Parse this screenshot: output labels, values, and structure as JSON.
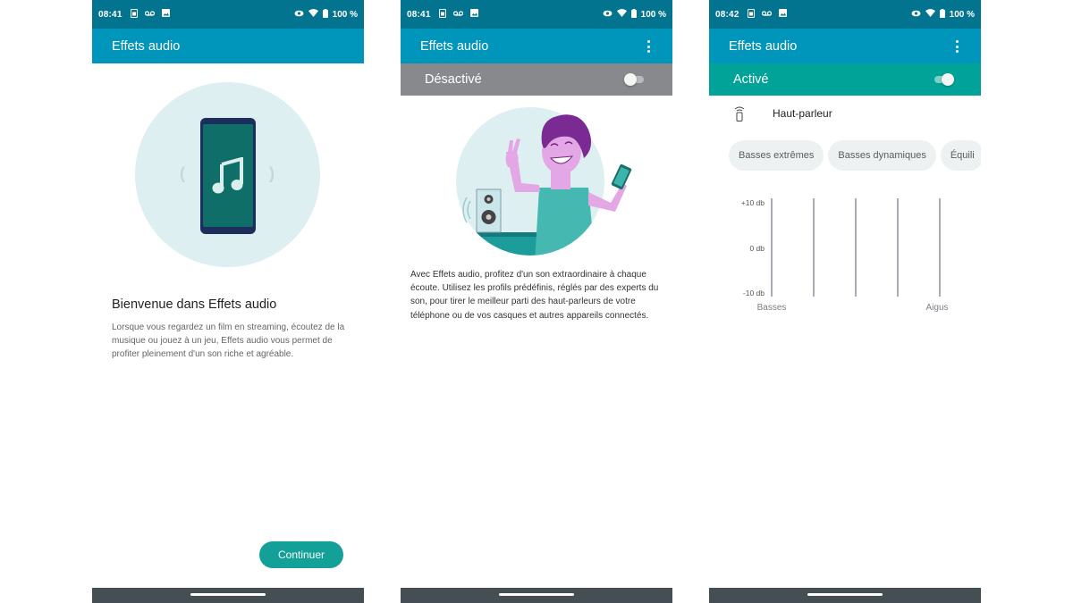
{
  "screens": [
    {
      "status": {
        "time": "08:41",
        "battery": "100 %"
      },
      "app_title": "Effets audio",
      "welcome_title": "Bienvenue dans Effets audio",
      "welcome_body": "Lorsque vous regardez un film en streaming, écoutez de la musique ou jouez à un jeu, Effets audio vous permet de profiter pleinement d'un son riche et agréable.",
      "continue_label": "Continuer"
    },
    {
      "status": {
        "time": "08:41",
        "battery": "100 %"
      },
      "app_title": "Effets audio",
      "toggle_label": "Désactivé",
      "toggle_on": false,
      "description": "Avec Effets audio, profitez d'un son extraordinaire à chaque écoute. Utilisez les profils prédéfinis, réglés par des experts du son, pour tirer le meilleur parti des haut-parleurs de votre téléphone ou de vos casques et autres appareils connectés."
    },
    {
      "status": {
        "time": "08:42",
        "battery": "100 %"
      },
      "app_title": "Effets audio",
      "toggle_label": "Activé",
      "toggle_on": true,
      "device_label": "Haut-parleur",
      "presets": [
        "Basses extrêmes",
        "Basses dynamiques",
        "Équili"
      ],
      "equalizer": {
        "y_labels": [
          "+10 db",
          "0 db",
          "-10 db"
        ],
        "x_labels": [
          "Basses",
          "Aigus"
        ],
        "ylim": [
          -10,
          10
        ],
        "bands": 5,
        "values_db": [
          0,
          0,
          0,
          0,
          0
        ]
      }
    }
  ],
  "colors": {
    "status_bar": "#03748f",
    "app_bar": "#0095bb",
    "toggle_off": "#87898c",
    "toggle_on": "#01a399",
    "accent": "#13a098",
    "nav_bar": "#454e52"
  },
  "icons": {
    "status_left": [
      "sim-icon",
      "voicemail-icon",
      "image-icon"
    ],
    "status_right": [
      "eye-icon",
      "wifi-icon",
      "battery-icon"
    ],
    "menu": "more-vert-icon",
    "device": "speaker-phone-icon",
    "illustration_1": "phone-music-note",
    "illustration_2": "person-with-speaker-and-phone"
  }
}
